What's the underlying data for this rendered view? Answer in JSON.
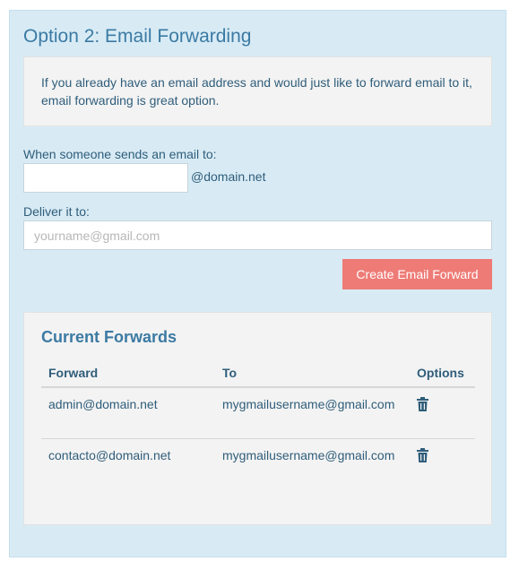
{
  "section": {
    "title": "Option 2: Email Forwarding",
    "info": "If you already have an email address and would just like to forward email to it, email forwarding is great option."
  },
  "form": {
    "send_label": "When someone sends an email to:",
    "from_value": "",
    "domain_suffix": "@domain.net",
    "deliver_label": "Deliver it to:",
    "to_placeholder": "yourname@gmail.com",
    "create_button": "Create Email Forward"
  },
  "forwards": {
    "title": "Current Forwards",
    "columns": [
      "Forward",
      "To",
      "Options"
    ],
    "rows": [
      {
        "forward": "admin@domain.net",
        "to": "mygmailusername@gmail.com",
        "option_icon": "trash-icon"
      },
      {
        "forward": "contacto@domain.net",
        "to": "mygmailusername@gmail.com",
        "option_icon": "trash-icon"
      }
    ]
  },
  "colors": {
    "panel_bg": "#d8ebf5",
    "title": "#3b7aa3",
    "text": "#2f5d7a",
    "button": "#ee7b76",
    "box_bg": "#f3f3f3"
  }
}
